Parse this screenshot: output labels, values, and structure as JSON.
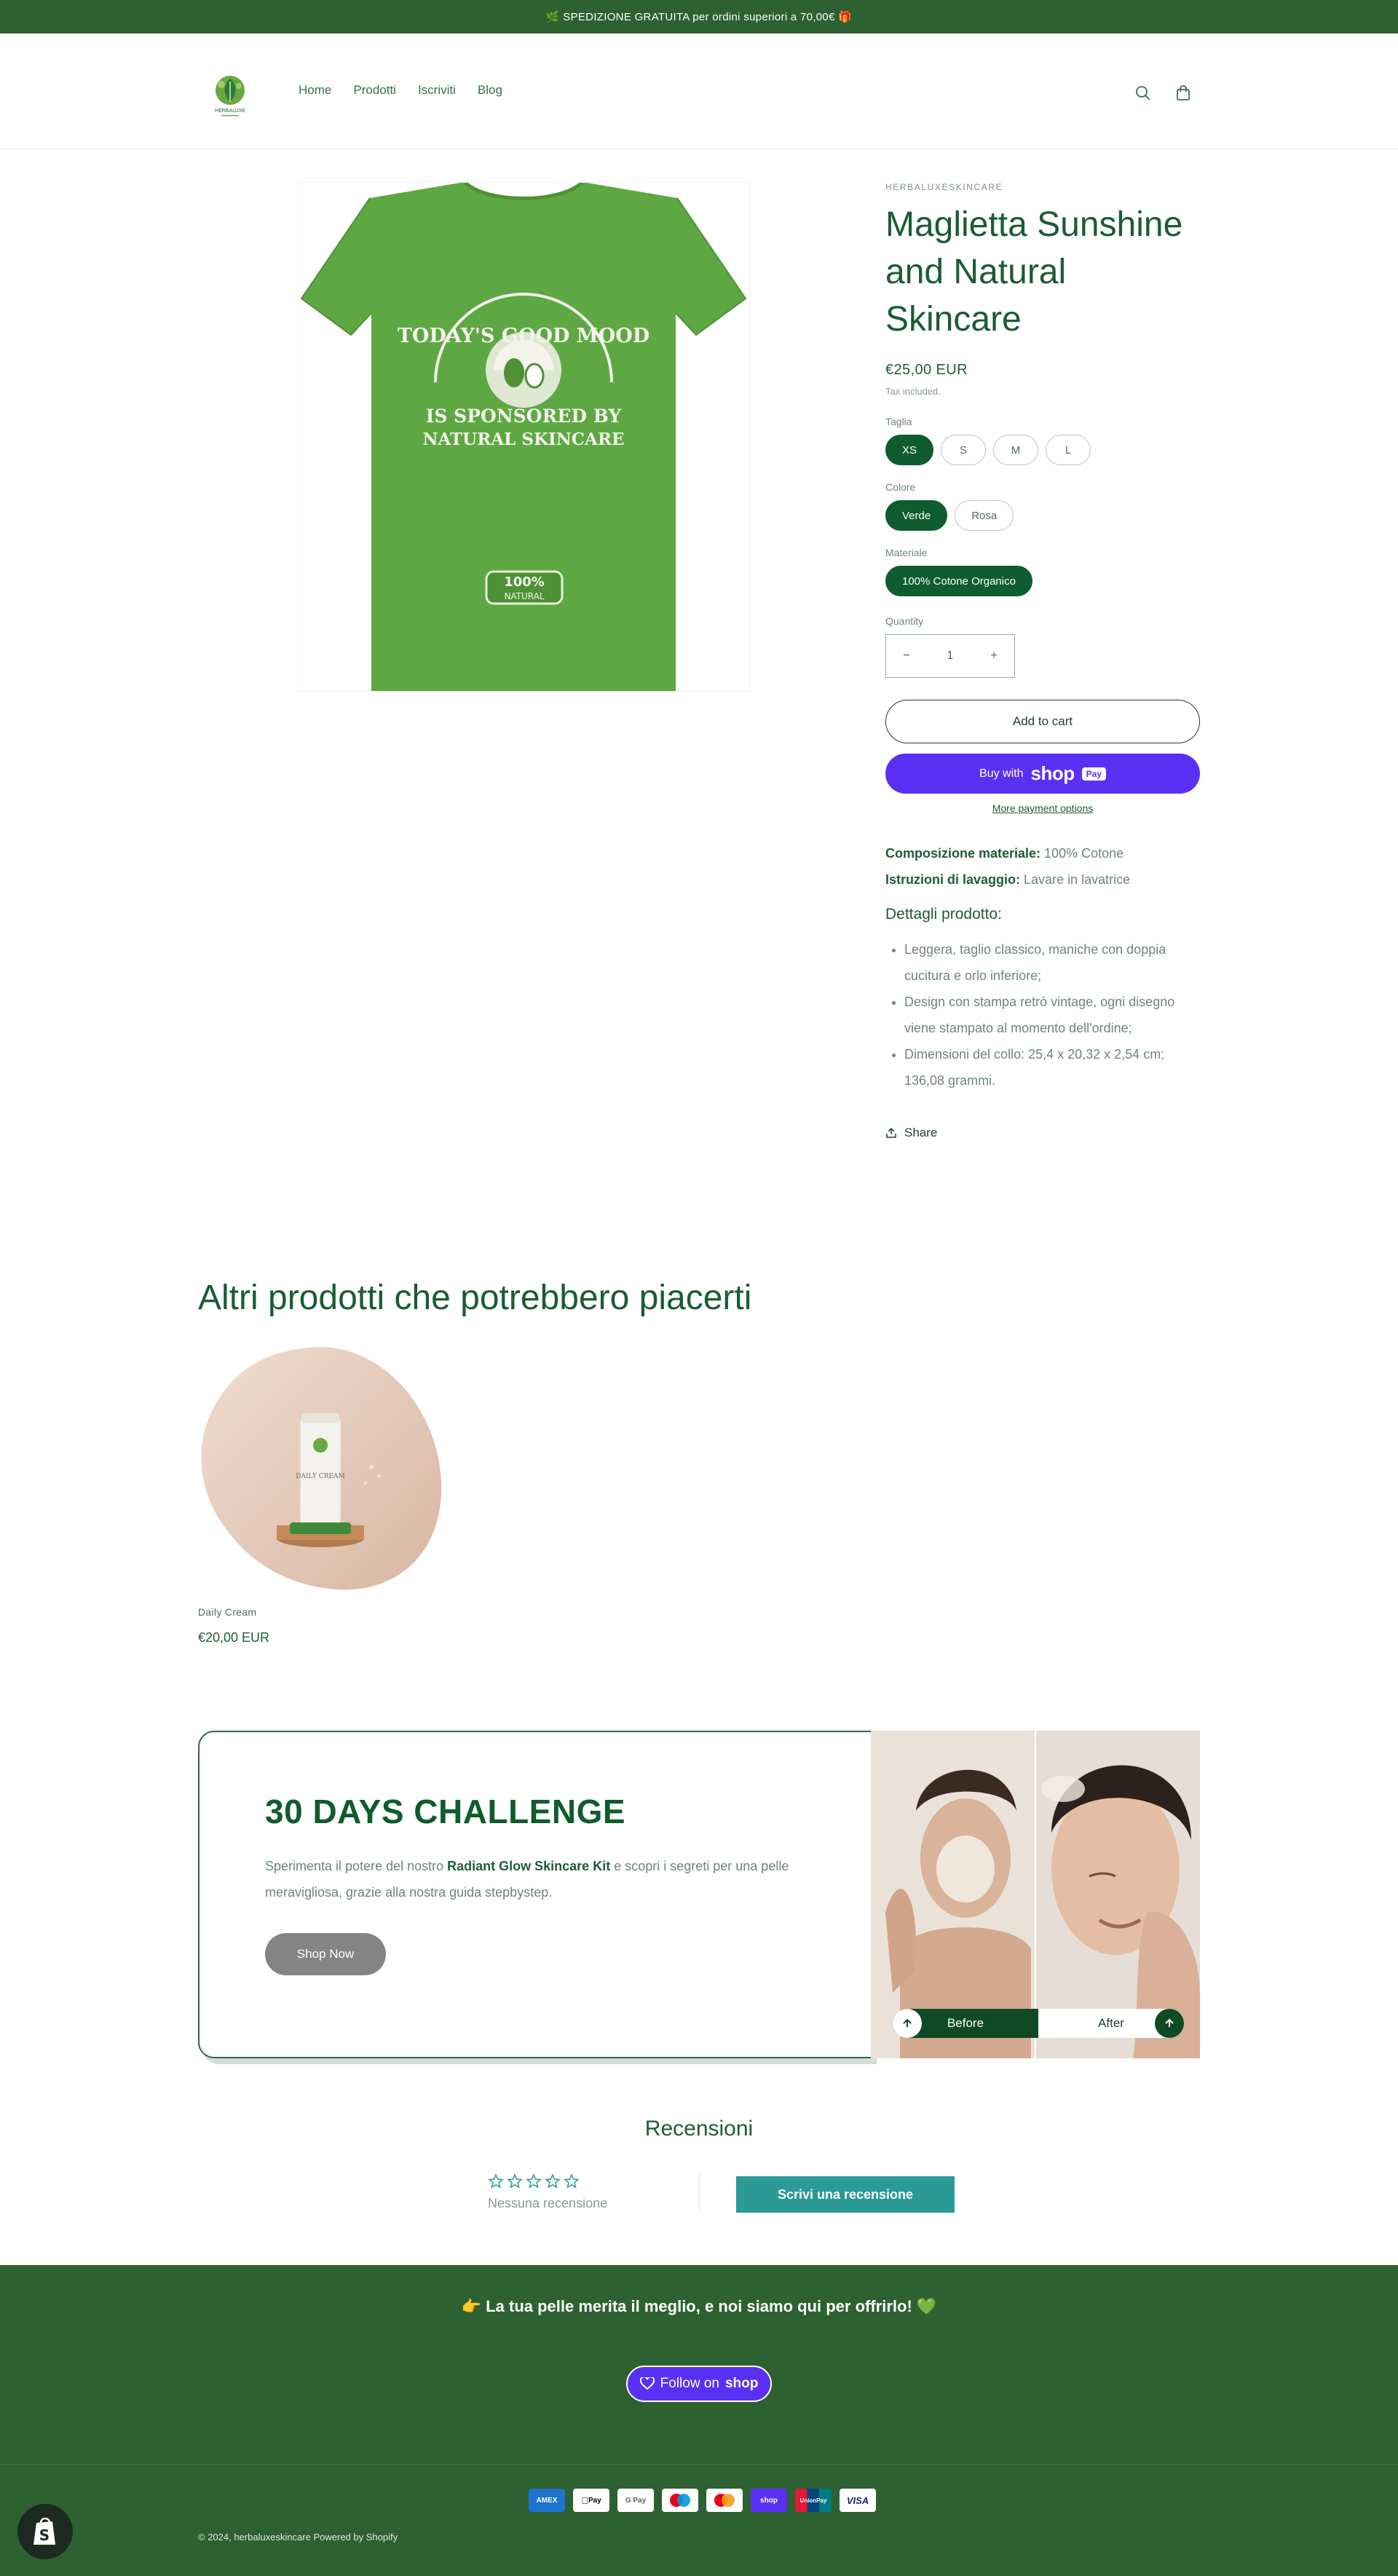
{
  "announcement": "🌿 SPEDIZIONE GRATUITA per ordini superiori a 70,00€ 🎁",
  "nav": [
    "Home",
    "Prodotti",
    "Iscriviti",
    "Blog"
  ],
  "logo_text": "HERBALUXE",
  "product": {
    "vendor": "HERBALUXESKINCARE",
    "title": "Maglietta Sunshine and Natural Skincare",
    "price": "€25,00 EUR",
    "tax": "Tax included.",
    "shirt_print": {
      "line1": "TODAY'S GOOD MOOD",
      "line2": "IS SPONSORED BY",
      "line3": "NATURAL SKINCARE",
      "badge_top": "100%",
      "badge_bottom": "NATURAL"
    },
    "options": {
      "size_label": "Taglia",
      "sizes": [
        "XS",
        "S",
        "M",
        "L"
      ],
      "color_label": "Colore",
      "colors": [
        "Verde",
        "Rosa"
      ],
      "material_label": "Materiale",
      "materials": [
        "100% Cotone Organico"
      ]
    },
    "quantity_label": "Quantity",
    "quantity": "1",
    "minus": "−",
    "plus": "+",
    "add_to_cart": "Add to cart",
    "buy_with": "Buy with",
    "shop_logo": "shop",
    "pay_badge": "Pay",
    "more_payment": "More payment options",
    "composition_label": "Composizione materiale:",
    "composition_value": " 100% Cotone",
    "washing_label": "Istruzioni di lavaggio:",
    "washing_value": " Lavare in lavatrice",
    "details_title": "Dettagli prodotto:",
    "details": [
      "Leggera, taglio classico, maniche con doppia cucitura e orlo inferiore;",
      "Design con stampa retrò vintage, ogni disegno viene stampato al momento dell'ordine;",
      "Dimensioni del collo:  25,4 x 20,32 x 2,54 cm; 136,08 grammi."
    ],
    "share": "Share"
  },
  "related": {
    "title": "Altri prodotti che potrebbero piacerti",
    "items": [
      {
        "name": "Daily Cream",
        "price": "€20,00 EUR",
        "tube_text": "DAILY CREAM"
      }
    ]
  },
  "challenge": {
    "title": "30 DAYS CHALLENGE",
    "text_before": "Sperimenta il potere del nostro ",
    "text_bold": "Radiant Glow Skincare Kit",
    "text_after": " e scopri i segreti per una pelle meravigliosa, grazie alla nostra guida stepbystep.",
    "button": "Shop Now",
    "before_label": "Before",
    "after_label": "After"
  },
  "reviews": {
    "title": "Recensioni",
    "none": "Nessuna recensione",
    "write": "Scrivi una recensione"
  },
  "footer": {
    "message": "👉 La tua pelle merita il meglio, e noi siamo qui per offrirlo! 💚",
    "follow_prefix": "Follow on",
    "follow_shop": "shop",
    "payments": [
      "AMEX",
      "Pay",
      "G Pay",
      "",
      "",
      "shop",
      "UnionPay",
      "VISA"
    ],
    "copyright_prefix": "© 2024, ",
    "store_name": "herbaluxeskincare",
    "powered": " Powered by Shopify"
  },
  "colors": {
    "brand_green": "#2d6131",
    "title_green": "#1a5c33",
    "shirt_green": "#5ea843",
    "shop_purple": "#5a31f4",
    "review_teal": "#2b9a96"
  }
}
